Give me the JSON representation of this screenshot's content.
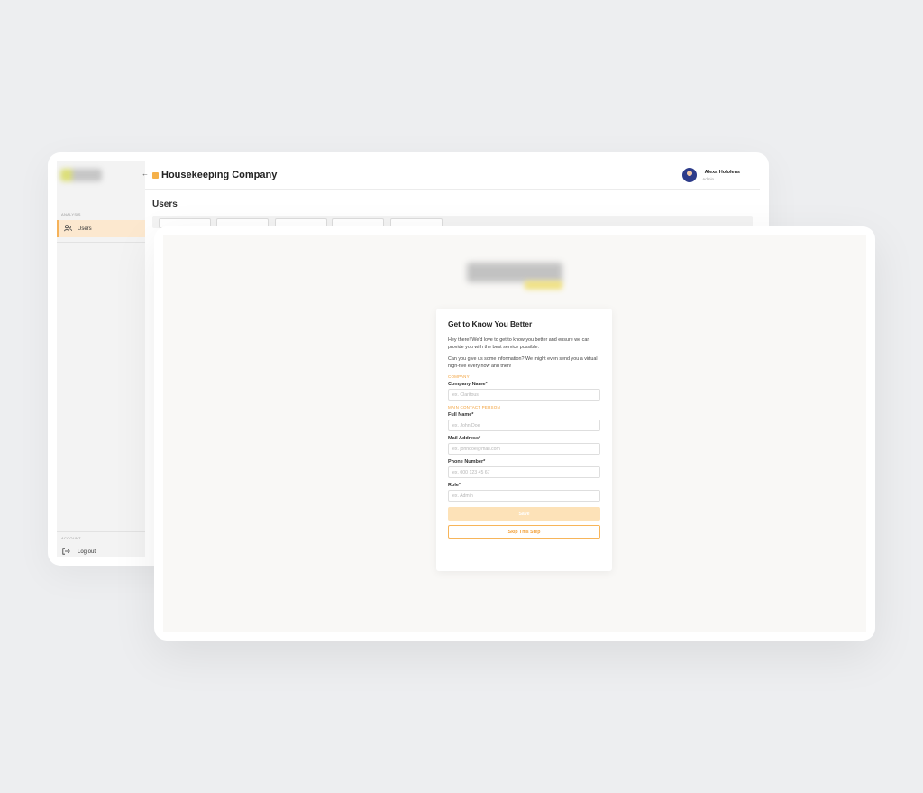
{
  "back_window": {
    "sidebar": {
      "section_analysis": "ANALYSIS",
      "nav_users_label": "Users",
      "section_account": "ACCOUNT",
      "logout_label": "Log out"
    },
    "header": {
      "back_icon": "arrow-left-icon",
      "company_title": "Housekeeping Company",
      "user_name": "Alexa Hololens",
      "user_role": "Admin"
    },
    "page_title": "Users"
  },
  "onboarding": {
    "title": "Get to Know You Better",
    "intro_1": "Hey there! We'd love to get to know you better and ensure we can provide you with the best service possible.",
    "intro_2": "Can you give us some information? We might even send you a virtual high-five every now and then!",
    "section_company": "COMPANY",
    "company_name_label": "Company Name*",
    "company_name_placeholder": "ex. Claritous",
    "section_contact": "MAIN CONTACT PERSON",
    "full_name_label": "Full Name*",
    "full_name_placeholder": "ex. John Doe",
    "mail_label": "Mail Address*",
    "mail_placeholder": "ex. johndoe@mail.com",
    "phone_label": "Phone Number*",
    "phone_placeholder": "ex. 000 123 45 67",
    "role_label": "Role*",
    "role_placeholder": "ex. Admin",
    "save_label": "Save",
    "skip_label": "Skip This Step"
  },
  "colors": {
    "accent": "#f2a13b",
    "accent_light": "#fde2b8",
    "background": "#edeef0"
  }
}
